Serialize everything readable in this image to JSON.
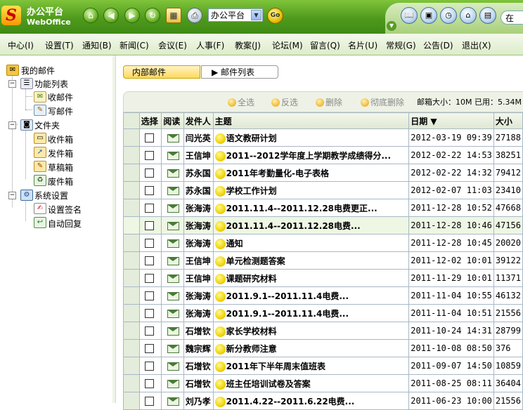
{
  "app": {
    "title": "办公平台",
    "subtitle": "WebOffice",
    "logo_letter": "S"
  },
  "toolbar_icons": [
    "home-icon",
    "back-icon",
    "forward-icon",
    "refresh-icon",
    "calendar-icon",
    "print-icon"
  ],
  "platform_select": {
    "value": "办公平台"
  },
  "go_label": "Go",
  "header_right": {
    "input_text": "在"
  },
  "menu": [
    {
      "label": "中心(I)"
    },
    {
      "label": "设置(T)"
    },
    {
      "label": "通知(B)"
    },
    {
      "label": "新闻(C)"
    },
    {
      "label": "会议(E)"
    },
    {
      "label": "人事(F)"
    },
    {
      "label": "教案(J)"
    },
    {
      "label": "论坛(M)"
    },
    {
      "label": "留言(Q)"
    },
    {
      "label": "名片(U)"
    },
    {
      "label": "常规(G)"
    },
    {
      "label": "公告(D)"
    },
    {
      "label": "退出(X)"
    }
  ],
  "tree": {
    "root": "我的邮件",
    "groups": [
      {
        "label": "功能列表",
        "items": [
          "收邮件",
          "写邮件"
        ]
      },
      {
        "label": "文件夹",
        "items": [
          "收件箱",
          "发件箱",
          "草稿箱",
          "废件箱"
        ]
      },
      {
        "label": "系统设置",
        "items": [
          "设置签名",
          "自动回复"
        ]
      }
    ]
  },
  "tabs": {
    "inbox": "内部邮件",
    "list": "▶ 邮件列表"
  },
  "actions": {
    "select_all": "全选",
    "invert": "反选",
    "delete": "删除",
    "purge": "彻底删除"
  },
  "mailbox_info": "邮箱大小：10M  已用：5.34M",
  "table": {
    "headers": {
      "select": "选择",
      "read": "阅读",
      "sender": "发件人",
      "subject": "主题",
      "date": "日期 ▼",
      "size": "大小"
    },
    "rows": [
      {
        "sender": "闫光英",
        "subject": "语文教研计划",
        "date": "2012-03-19 09:39",
        "size": "27188"
      },
      {
        "sender": "王信坤",
        "subject": "2011--2012学年度上学期教学成绩得分...",
        "date": "2012-02-22 14:53",
        "size": "38251"
      },
      {
        "sender": "苏永国",
        "subject": "2011年考勤量化-电子表格",
        "date": "2012-02-22 14:32",
        "size": "79412"
      },
      {
        "sender": "苏永国",
        "subject": "学校工作计划",
        "date": "2012-02-07 11:03",
        "size": "23410"
      },
      {
        "sender": "张海涛",
        "subject": "2011.11.4--2011.12.28电费更正...",
        "date": "2011-12-28 10:52",
        "size": "47668"
      },
      {
        "sender": "张海涛",
        "subject": "2011.11.4--2011.12.28电费...",
        "date": "2011-12-28 10:46",
        "size": "47156"
      },
      {
        "sender": "张海涛",
        "subject": "通知",
        "date": "2011-12-28 10:45",
        "size": "20020"
      },
      {
        "sender": "王信坤",
        "subject": "单元检测题答案",
        "date": "2011-12-02 10:01",
        "size": "39122"
      },
      {
        "sender": "王信坤",
        "subject": "课题研究材料",
        "date": "2011-11-29 10:01",
        "size": "11371"
      },
      {
        "sender": "张海涛",
        "subject": "2011.9.1--2011.11.4电费...",
        "date": "2011-11-04 10:55",
        "size": "46132"
      },
      {
        "sender": "张海涛",
        "subject": "2011.9.1--2011.11.4电费...",
        "date": "2011-11-04 10:51",
        "size": "21556"
      },
      {
        "sender": "石增钦",
        "subject": "家长学校材料",
        "date": "2011-10-24 14:31",
        "size": "28799"
      },
      {
        "sender": "魏宗辉",
        "subject": "新分教师注意",
        "date": "2011-10-08 08:50",
        "size": "376"
      },
      {
        "sender": "石增钦",
        "subject": "2011年下半年周末值班表",
        "date": "2011-09-07 14:50",
        "size": "10859"
      },
      {
        "sender": "石增钦",
        "subject": "班主任培训试卷及答案",
        "date": "2011-08-25 08:11",
        "size": "36404"
      },
      {
        "sender": "刘乃孝",
        "subject": "2011.4.22--2011.6.22电费...",
        "date": "2011-06-23 10:00",
        "size": "21556"
      }
    ]
  }
}
